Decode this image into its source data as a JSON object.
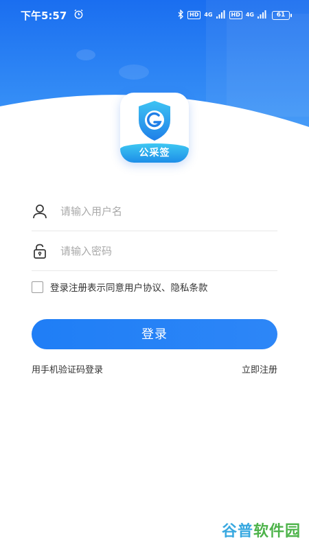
{
  "status_bar": {
    "time": "下午5:57",
    "hd_label": "HD",
    "net_label": "4G",
    "battery": "61"
  },
  "app": {
    "logo_text": "公采签"
  },
  "form": {
    "username_placeholder": "请输入用户名",
    "password_placeholder": "请输入密码"
  },
  "agreement": {
    "text": "登录注册表示同意用户协议、隐私条款",
    "checked": false
  },
  "actions": {
    "login_label": "登录",
    "sms_login_label": "用手机验证码登录",
    "register_label": "立即注册"
  },
  "watermark": {
    "part1": "谷普",
    "part2": "软件园"
  },
  "colors": {
    "primary": "#1f7ef6",
    "header_top": "#1b6ff0",
    "header_bottom": "#3d96f7"
  }
}
